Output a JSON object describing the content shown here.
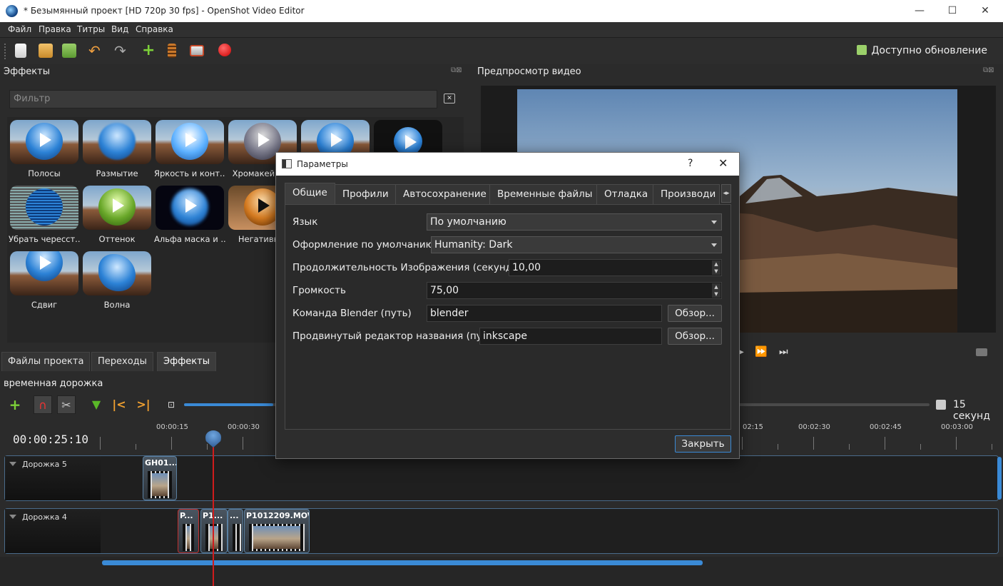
{
  "window": {
    "title": "* Безымянный проект [HD 720p 30 fps] - OpenShot Video Editor",
    "controls": {
      "minimize": "—",
      "maximize": "☐",
      "close": "✕"
    }
  },
  "menu": [
    "Файл",
    "Правка",
    "Титры",
    "Вид",
    "Справка"
  ],
  "toolbar": {
    "icons": [
      "new-project-icon",
      "open-project-icon",
      "save-project-icon",
      "undo-icon",
      "redo-icon",
      "import-files-icon",
      "profile-icon",
      "fullscreen-icon",
      "export-video-icon"
    ],
    "update_label": "Доступно обновление"
  },
  "effects_panel": {
    "title": "Эффекты",
    "filter_placeholder": "Фильтр",
    "clear_glyph": "✕",
    "items": [
      {
        "label": "Полосы"
      },
      {
        "label": "Размытие"
      },
      {
        "label": "Яркость и конт..."
      },
      {
        "label": "Хромакей (з..."
      },
      {
        "label": ""
      },
      {
        "label": ""
      },
      {
        "label": "Убрать чересст..."
      },
      {
        "label": "Оттенок"
      },
      {
        "label": "Альфа маска и ..."
      },
      {
        "label": "Негативн..."
      },
      {
        "label": "Сдвиг"
      },
      {
        "label": "Волна"
      }
    ]
  },
  "project_tabs": [
    "Файлы проекта",
    "Переходы",
    "Эффекты"
  ],
  "preview": {
    "title": "Предпросмотр видео",
    "controls": [
      "▶",
      "⏩",
      "⏭"
    ]
  },
  "timeline": {
    "title": "временная дорожка",
    "timecode": "00:00:25:10",
    "zoom_label": "15 секунд",
    "zoom_fraction": 0.12,
    "ticks": [
      "00:00:15",
      "00:00:30",
      "02:15",
      "00:02:30",
      "00:02:45",
      "00:03:00"
    ],
    "tracks": [
      {
        "name": "Дорожка 5",
        "clips": [
          {
            "label": "GH01..."
          }
        ]
      },
      {
        "name": "Дорожка 4",
        "clips": [
          {
            "label": "P..."
          },
          {
            "label": "P1..."
          },
          {
            "label": "..."
          },
          {
            "label": "P1012209.MOV"
          }
        ]
      }
    ]
  },
  "dialog": {
    "title": "Параметры",
    "help": "?",
    "close": "✕",
    "tabs": [
      "Общие",
      "Профили",
      "Автосохранение",
      "Временные файлы",
      "Отладка",
      "Производи"
    ],
    "active_tab": "Общие",
    "rows": {
      "language": {
        "label": "Язык",
        "value": "По умолчанию"
      },
      "theme": {
        "label": "Оформление по умолчанию",
        "value": "Humanity: Dark"
      },
      "image_duration": {
        "label": "Продолжительность Изображения (секунды)",
        "value": "10,00"
      },
      "volume": {
        "label": "Громкость",
        "value": "75,00"
      },
      "blender": {
        "label": "Команда Blender (путь)",
        "value": "blender",
        "browse": "Обзор..."
      },
      "title_editor": {
        "label": "Продвинутый редактор названия (путь)",
        "value": "inkscape",
        "browse": "Обзор..."
      }
    },
    "close_label": "Закрыть"
  },
  "colors": {
    "accent": "#3a8ad6",
    "playhead": "#d01c1c",
    "update_green": "#9bd06a"
  }
}
